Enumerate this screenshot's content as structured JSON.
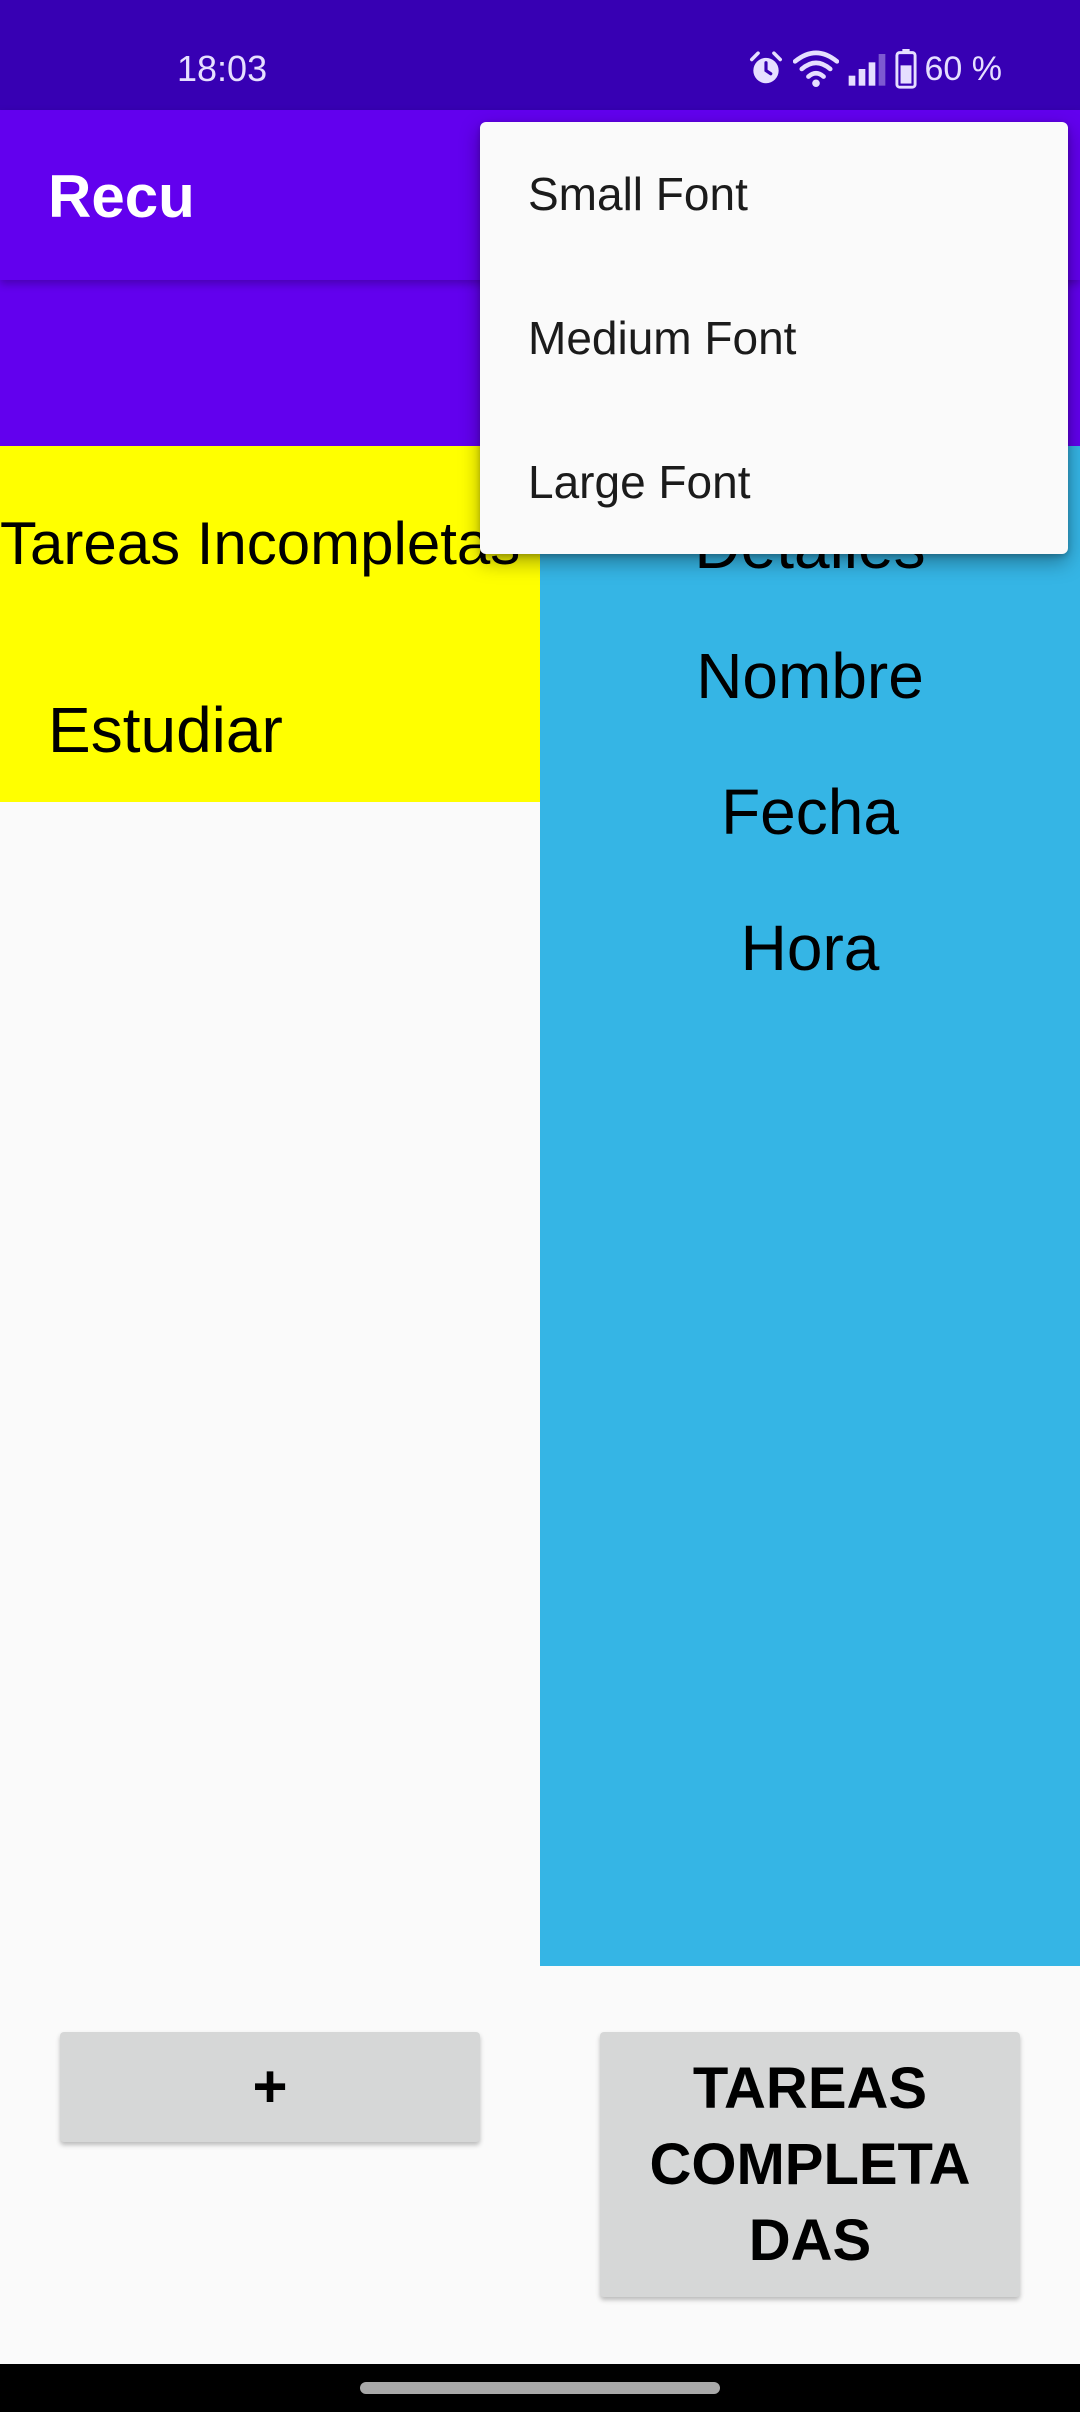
{
  "status_bar": {
    "time": "18:03",
    "battery_text": "60 %",
    "icons": [
      "alarm-icon",
      "wifi-icon",
      "signal-icon",
      "battery-icon"
    ]
  },
  "app_bar": {
    "title": "Recu"
  },
  "left_panel": {
    "title": "Tareas Incompletas",
    "items": [
      "Estudiar"
    ]
  },
  "right_panel": {
    "title": "Detalles",
    "nombre": "Nombre",
    "fecha": "Fecha",
    "hora": "Hora"
  },
  "buttons": {
    "add_label": "+",
    "completed_label": "TAREAS\nCOMPLETA\nDAS"
  },
  "menu": {
    "items": [
      {
        "label": "Small Font"
      },
      {
        "label": "Medium Font"
      },
      {
        "label": "Large Font"
      }
    ]
  },
  "colors": {
    "status_bar": "#3700B3",
    "app_bar": "#6200EE",
    "left_panel": "#FFFF00",
    "right_panel": "#35B5E5",
    "button": "#D6D7D7",
    "background": "#FAFAFA"
  }
}
